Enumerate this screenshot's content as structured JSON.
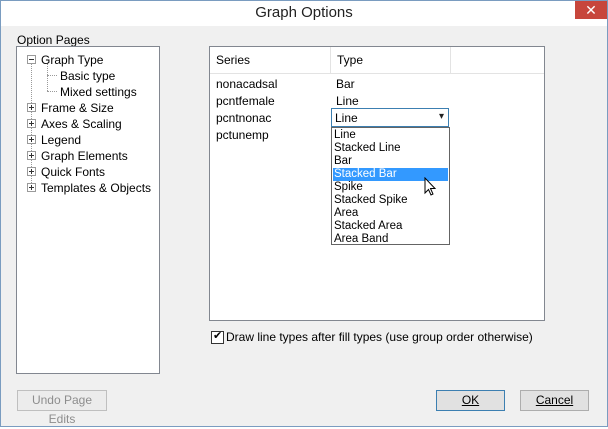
{
  "window": {
    "title": "Graph Options",
    "close_glyph": "✕"
  },
  "option_pages": {
    "label": "Option Pages",
    "tree": [
      {
        "label": "Graph Type"
      },
      {
        "label": "Basic type"
      },
      {
        "label": "Mixed settings"
      },
      {
        "label": "Frame & Size"
      },
      {
        "label": "Axes & Scaling"
      },
      {
        "label": "Legend"
      },
      {
        "label": "Graph Elements"
      },
      {
        "label": "Quick Fonts"
      },
      {
        "label": "Templates & Objects"
      }
    ]
  },
  "series_table": {
    "headers": [
      "Series",
      "Type"
    ],
    "rows": [
      {
        "series": "nonacadsal",
        "type": "Bar"
      },
      {
        "series": "pcntfemale",
        "type": "Line"
      },
      {
        "series": "pcntnonac",
        "type": "Line"
      },
      {
        "series": "pctunemp",
        "type": ""
      }
    ]
  },
  "type_dropdown": {
    "selected": "Line",
    "arrow_glyph": "▾",
    "options": [
      "Line",
      "Stacked Line",
      "Bar",
      "Stacked Bar",
      "Spike",
      "Stacked Spike",
      "Area",
      "Stacked Area",
      "Area Band"
    ],
    "highlighted": "Stacked Bar"
  },
  "draw_order_checkbox": {
    "checked": true,
    "mark": "✔",
    "label": "Draw line types after fill types (use group order otherwise)"
  },
  "buttons": {
    "undo": "Undo Page Edits",
    "ok": "OK",
    "cancel": "Cancel"
  },
  "colors": {
    "selection": "#3399ff",
    "close_button": "#c7463c",
    "focus_border": "#3c7fb1"
  }
}
